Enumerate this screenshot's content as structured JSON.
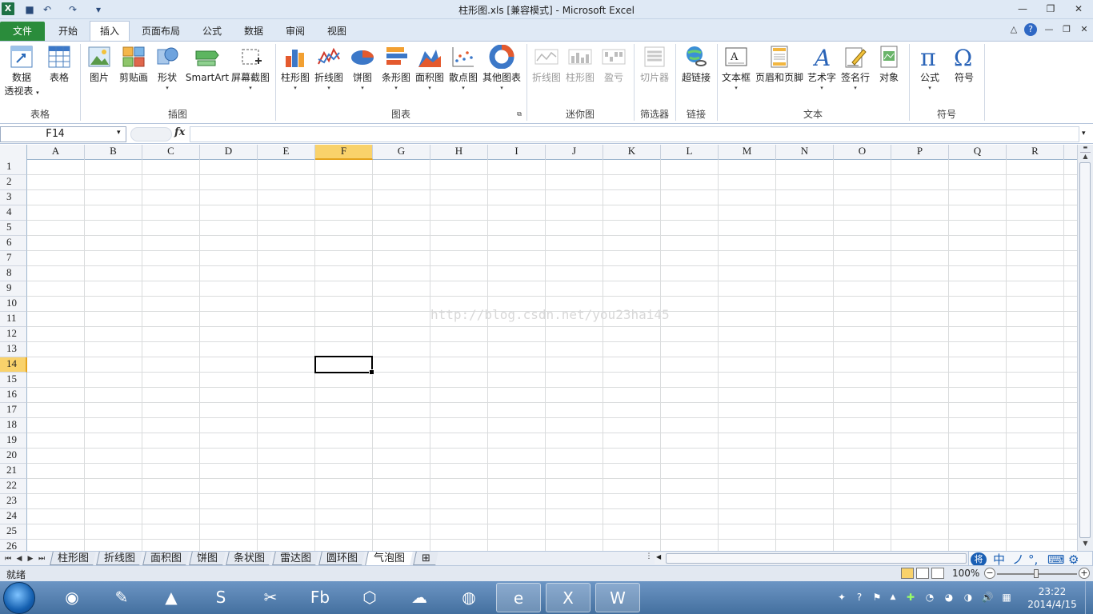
{
  "window": {
    "title": "柱形图.xls  [兼容模式] - Microsoft Excel",
    "app_badge": "X"
  },
  "quick_access": [
    {
      "name": "save-icon",
      "glyph": "■"
    },
    {
      "name": "undo-icon",
      "glyph": "↶"
    },
    {
      "name": "redo-icon",
      "glyph": "↷"
    },
    {
      "name": "customize-qat-icon",
      "glyph": "▾"
    }
  ],
  "window_controls": {
    "minimize": "—",
    "restore": "❐",
    "close": "✕"
  },
  "ribbon_tabs": [
    "文件",
    "开始",
    "插入",
    "页面布局",
    "公式",
    "数据",
    "审阅",
    "视图"
  ],
  "active_tab": "插入",
  "ribbon_right_icons": [
    "△",
    "?",
    "—",
    "❐",
    "✕"
  ],
  "ribbon": {
    "groups": [
      {
        "label": "表格",
        "buttons": [
          {
            "label": "数据",
            "label2": "透视表",
            "name": "pivottable-button",
            "icon": "pivot-icon"
          },
          {
            "label": "表格",
            "name": "table-button",
            "icon": "table-icon"
          }
        ]
      },
      {
        "label": "插图",
        "buttons": [
          {
            "label": "图片",
            "name": "picture-button",
            "icon": "picture-icon"
          },
          {
            "label": "剪贴画",
            "name": "clipart-button",
            "icon": "clipart-icon"
          },
          {
            "label": "形状",
            "name": "shapes-button",
            "icon": "shapes-icon"
          },
          {
            "label": "SmartArt",
            "name": "smartart-button",
            "icon": "smartart-icon"
          },
          {
            "label": "屏幕截图",
            "name": "screenshot-button",
            "icon": "screenshot-icon"
          }
        ]
      },
      {
        "label": "图表",
        "buttons": [
          {
            "label": "柱形图",
            "name": "column-chart-button",
            "icon": "column-chart-icon"
          },
          {
            "label": "折线图",
            "name": "line-chart-button",
            "icon": "line-chart-icon"
          },
          {
            "label": "饼图",
            "name": "pie-chart-button",
            "icon": "pie-chart-icon"
          },
          {
            "label": "条形图",
            "name": "bar-chart-button",
            "icon": "bar-chart-icon"
          },
          {
            "label": "面积图",
            "name": "area-chart-button",
            "icon": "area-chart-icon"
          },
          {
            "label": "散点图",
            "name": "scatter-chart-button",
            "icon": "scatter-chart-icon"
          },
          {
            "label": "其他图表",
            "name": "other-charts-button",
            "icon": "donut-chart-icon"
          }
        ]
      },
      {
        "label": "迷你图",
        "buttons": [
          {
            "label": "折线图",
            "name": "sparkline-line-button",
            "icon": "sparkline-line-icon"
          },
          {
            "label": "柱形图",
            "name": "sparkline-column-button",
            "icon": "sparkline-column-icon"
          },
          {
            "label": "盈亏",
            "name": "sparkline-winloss-button",
            "icon": "winloss-icon"
          }
        ]
      },
      {
        "label": "筛选器",
        "buttons": [
          {
            "label": "切片器",
            "name": "slicer-button",
            "icon": "slicer-icon"
          }
        ]
      },
      {
        "label": "链接",
        "buttons": [
          {
            "label": "超链接",
            "name": "hyperlink-button",
            "icon": "hyperlink-icon"
          }
        ]
      },
      {
        "label": "文本",
        "buttons": [
          {
            "label": "文本框",
            "name": "textbox-button",
            "icon": "textbox-icon"
          },
          {
            "label": "页眉和页脚",
            "name": "header-footer-button",
            "icon": "header-footer-icon"
          },
          {
            "label": "艺术字",
            "name": "wordart-button",
            "icon": "wordart-icon"
          },
          {
            "label": "签名行",
            "name": "signature-line-button",
            "icon": "signature-icon"
          },
          {
            "label": "对象",
            "name": "object-button",
            "icon": "object-icon"
          }
        ]
      },
      {
        "label": "符号",
        "buttons": [
          {
            "label": "公式",
            "name": "equation-button",
            "icon": "pi-icon"
          },
          {
            "label": "符号",
            "name": "symbol-button",
            "icon": "omega-icon"
          }
        ]
      }
    ]
  },
  "formula_bar": {
    "name_box": "F14",
    "fx": "fx",
    "formula": ""
  },
  "grid": {
    "columns": [
      "A",
      "B",
      "C",
      "D",
      "E",
      "F",
      "G",
      "H",
      "I",
      "J",
      "K",
      "L",
      "M",
      "N",
      "O",
      "P",
      "Q",
      "R"
    ],
    "rows": [
      "1",
      "2",
      "3",
      "4",
      "5",
      "6",
      "7",
      "8",
      "9",
      "10",
      "11",
      "12",
      "13",
      "14",
      "15",
      "16",
      "17",
      "18",
      "19",
      "20",
      "21",
      "22",
      "23",
      "24",
      "25",
      "26"
    ],
    "selected_column": "F",
    "selected_row": "14"
  },
  "watermark": "http://blog.csdn.net/you23hai45",
  "sheet_nav": [
    "⏮",
    "◀",
    "▶",
    "⏭"
  ],
  "sheet_tabs": [
    "柱形图",
    "折线图",
    "面积图",
    "饼图",
    "条状图",
    "雷达图",
    "圆环图",
    "气泡图"
  ],
  "active_sheet": "气泡图",
  "ime": {
    "badge": "将",
    "chars": [
      "中",
      "ノ",
      "°,",
      "⌨",
      "⚙"
    ]
  },
  "status": {
    "text": "就绪",
    "zoom": "100%"
  },
  "taskbar": {
    "apps": [
      {
        "name": "eclipse-icon",
        "glyph": "◉"
      },
      {
        "name": "notepad-plus-icon",
        "glyph": "✎"
      },
      {
        "name": "matlab-icon",
        "glyph": "▲"
      },
      {
        "name": "sublime-icon",
        "glyph": "S"
      },
      {
        "name": "snipping-tool-icon",
        "glyph": "✂"
      },
      {
        "name": "flash-builder-icon",
        "glyph": "Fb"
      },
      {
        "name": "virtualbox-icon",
        "glyph": "⬡"
      },
      {
        "name": "cloud-drive-icon",
        "glyph": "☁"
      },
      {
        "name": "firefox-icon",
        "glyph": "◍"
      },
      {
        "name": "ie-icon",
        "glyph": "e"
      },
      {
        "name": "excel-taskbar-icon",
        "glyph": "X"
      },
      {
        "name": "word-taskbar-icon",
        "glyph": "W"
      }
    ],
    "tray": [
      "✦",
      "?",
      "⚑",
      "▲",
      "✚",
      "◔",
      "◕",
      "◑",
      "🔊",
      "▦"
    ],
    "time": "23:22",
    "date": "2014/4/15"
  },
  "colors": {
    "accent_green": "#2a8c3b",
    "selection_header": "#f9d26b",
    "selection_underline": "#e4a31e",
    "gridline": "#dadcdd"
  }
}
